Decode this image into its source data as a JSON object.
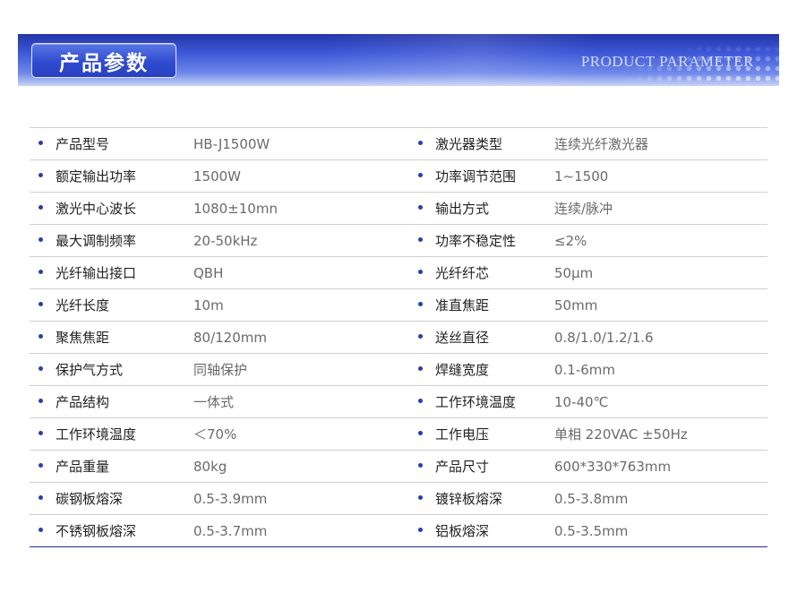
{
  "header": {
    "title": "产品参数",
    "subtitle": "PRODUCT PARAMETER"
  },
  "rows": [
    {
      "left_label": "产品型号",
      "left_value": "HB-J1500W",
      "right_label": "激光器类型",
      "right_value": "连续光纤激光器"
    },
    {
      "left_label": "额定输出功率",
      "left_value": "1500W",
      "right_label": "功率调节范围",
      "right_value": "1~1500"
    },
    {
      "left_label": "激光中心波长",
      "left_value": "1080±10mn",
      "right_label": "输出方式",
      "right_value": "连续/脉冲"
    },
    {
      "left_label": "最大调制频率",
      "left_value": "20-50kHz",
      "right_label": "功率不稳定性",
      "right_value": "≤2%"
    },
    {
      "left_label": "光纤输出接口",
      "left_value": "QBH",
      "right_label": "光纤纤芯",
      "right_value": "50μm"
    },
    {
      "left_label": "光纤长度",
      "left_value": "10m",
      "right_label": "准直焦距",
      "right_value": "50mm"
    },
    {
      "left_label": "聚焦焦距",
      "left_value": "80/120mm",
      "right_label": "送丝直径",
      "right_value": "0.8/1.0/1.2/1.6"
    },
    {
      "left_label": "保护气方式",
      "left_value": "同轴保护",
      "right_label": "焊缝宽度",
      "right_value": "0.1-6mm"
    },
    {
      "left_label": "产品结构",
      "left_value": "一体式",
      "right_label": "工作环境温度",
      "right_value": "10-40℃"
    },
    {
      "left_label": "工作环境温度",
      "left_value": "＜70%",
      "right_label": "工作电压",
      "right_value": "单相 220VAC ±50Hz"
    },
    {
      "left_label": "产品重量",
      "left_value": "80kg",
      "right_label": "产品尺寸",
      "right_value": "600*330*763mm"
    },
    {
      "left_label": "碳钢板熔深",
      "left_value": "0.5-3.9mm",
      "right_label": "镀锌板熔深",
      "right_value": "0.5-3.8mm"
    },
    {
      "left_label": "不锈钢板熔深",
      "left_value": "0.5-3.7mm",
      "right_label": "铝板熔深",
      "right_value": "0.5-3.5mm"
    }
  ],
  "colors": {
    "accent": "#2a3ea8",
    "banner_dark": "#2436a8",
    "banner_light": "#c9d4f7"
  }
}
